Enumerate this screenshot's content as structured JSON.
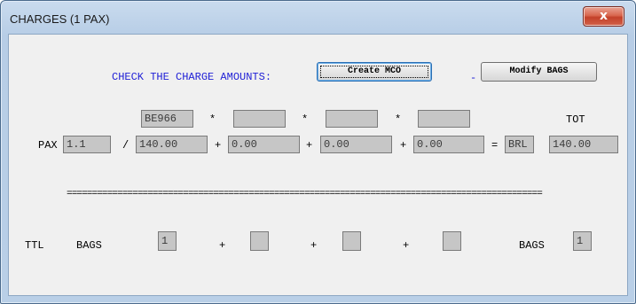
{
  "window": {
    "title": "CHARGES (1 PAX)",
    "close_label": "x"
  },
  "header": {
    "check_label": "CHECK THE CHARGE AMOUNTS:",
    "create_mco_label": "Create MCO",
    "dash": "-",
    "modify_bags_label": "Modify BAGS"
  },
  "codes": [
    "BE966",
    "",
    "",
    ""
  ],
  "star": "*",
  "tot_label": "TOT",
  "pax_row": {
    "label": "PAX",
    "pax_no": "1.1",
    "slash": "/",
    "amounts": [
      "140.00",
      "0.00",
      "0.00",
      "0.00"
    ],
    "plus": "+",
    "equals": "=",
    "currency": "BRL",
    "total": "140.00"
  },
  "separator": "==============================================================================================",
  "bags_row": {
    "ttl_label": "TTL",
    "bags_label": "BAGS",
    "bag_values": [
      "1",
      "",
      "",
      ""
    ],
    "plus": "+",
    "total_label": "BAGS",
    "total_value": "1"
  }
}
